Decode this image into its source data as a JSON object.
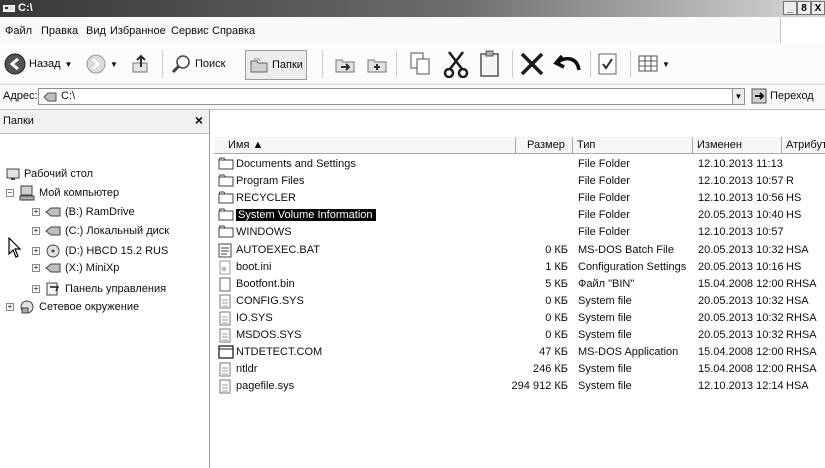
{
  "window": {
    "title": "C:\\",
    "controls": {
      "minimize": "_",
      "maximize": "8",
      "close": "X"
    }
  },
  "menu": [
    "Файл",
    "Правка",
    "Вид",
    "Избранное",
    "Сервис",
    "Справка"
  ],
  "toolbar": {
    "back_label": "Назад",
    "search_label": "Поиск",
    "folders_label": "Папки"
  },
  "address": {
    "label": "Адрес:",
    "value": "C:\\",
    "go_label": "Переход"
  },
  "folders_pane": {
    "title": "Папки",
    "close": "×",
    "tree": [
      {
        "label": "Рабочий стол",
        "icon": "desktop-icon",
        "expander": ""
      },
      {
        "label": "Мой компьютер",
        "icon": "computer-icon",
        "expander": "−"
      },
      {
        "label": "(B:) RamDrive",
        "icon": "drive-icon",
        "expander": "+"
      },
      {
        "label": "(C:) Локальный диск",
        "icon": "drive-icon",
        "expander": "+"
      },
      {
        "label": "(D:) HBCD 15.2 RUS",
        "icon": "cd-drive-icon",
        "expander": "+"
      },
      {
        "label": "(X:) MiniXp",
        "icon": "drive-icon",
        "expander": "+"
      },
      {
        "label": "Панель управления",
        "icon": "control-panel-icon",
        "expander": "+"
      },
      {
        "label": "Сетевое окружение",
        "icon": "network-icon",
        "expander": "+"
      }
    ]
  },
  "file_list": {
    "columns": {
      "name": "Имя ▲",
      "size": "Размер",
      "type": "Тип",
      "modified": "Изменен",
      "attributes": "Атрибуты"
    },
    "rows": [
      {
        "name": "Documents and Settings",
        "icon": "folder-icon",
        "size": "",
        "type": "File Folder",
        "modified": "12.10.2013 11:13",
        "attributes": ""
      },
      {
        "name": "Program Files",
        "icon": "folder-icon",
        "size": "",
        "type": "File Folder",
        "modified": "12.10.2013 10:57",
        "attributes": "R"
      },
      {
        "name": "RECYCLER",
        "icon": "folder-icon",
        "size": "",
        "type": "File Folder",
        "modified": "12.10.2013 10:56",
        "attributes": "HS"
      },
      {
        "name": "System Volume Information",
        "icon": "folder-icon",
        "size": "",
        "type": "File Folder",
        "modified": "20.05.2013 10:40",
        "attributes": "HS",
        "selected": true
      },
      {
        "name": "WINDOWS",
        "icon": "folder-icon",
        "size": "",
        "type": "File Folder",
        "modified": "12.10.2013 10:57",
        "attributes": ""
      },
      {
        "name": "AUTOEXEC.BAT",
        "icon": "batch-file-icon",
        "size": "0 КБ",
        "type": "MS-DOS Batch File",
        "modified": "20.05.2013 10:32",
        "attributes": "HSA"
      },
      {
        "name": "boot.ini",
        "icon": "settings-file-icon",
        "size": "1 КБ",
        "type": "Configuration Settings",
        "modified": "20.05.2013 10:16",
        "attributes": "HS"
      },
      {
        "name": "Bootfont.bin",
        "icon": "file-icon",
        "size": "5 КБ",
        "type": "Файл \"BIN\"",
        "modified": "15.04.2008 12:00",
        "attributes": "RHSA"
      },
      {
        "name": "CONFIG.SYS",
        "icon": "system-file-icon",
        "size": "0 КБ",
        "type": "System file",
        "modified": "20.05.2013 10:32",
        "attributes": "HSA"
      },
      {
        "name": "IO.SYS",
        "icon": "system-file-icon",
        "size": "0 КБ",
        "type": "System file",
        "modified": "20.05.2013 10:32",
        "attributes": "RHSA"
      },
      {
        "name": "MSDOS.SYS",
        "icon": "system-file-icon",
        "size": "0 КБ",
        "type": "System file",
        "modified": "20.05.2013 10:32",
        "attributes": "RHSA"
      },
      {
        "name": "NTDETECT.COM",
        "icon": "application-icon",
        "size": "47 КБ",
        "type": "MS-DOS Application",
        "modified": "15.04.2008 12:00",
        "attributes": "RHSA"
      },
      {
        "name": "ntldr",
        "icon": "system-file-icon",
        "size": "246 КБ",
        "type": "System file",
        "modified": "15.04.2008 12:00",
        "attributes": "RHSA"
      },
      {
        "name": "pagefile.sys",
        "icon": "system-file-icon",
        "size": "294 912 КБ",
        "type": "System file",
        "modified": "12.10.2013 12:14",
        "attributes": "HSA"
      }
    ]
  }
}
